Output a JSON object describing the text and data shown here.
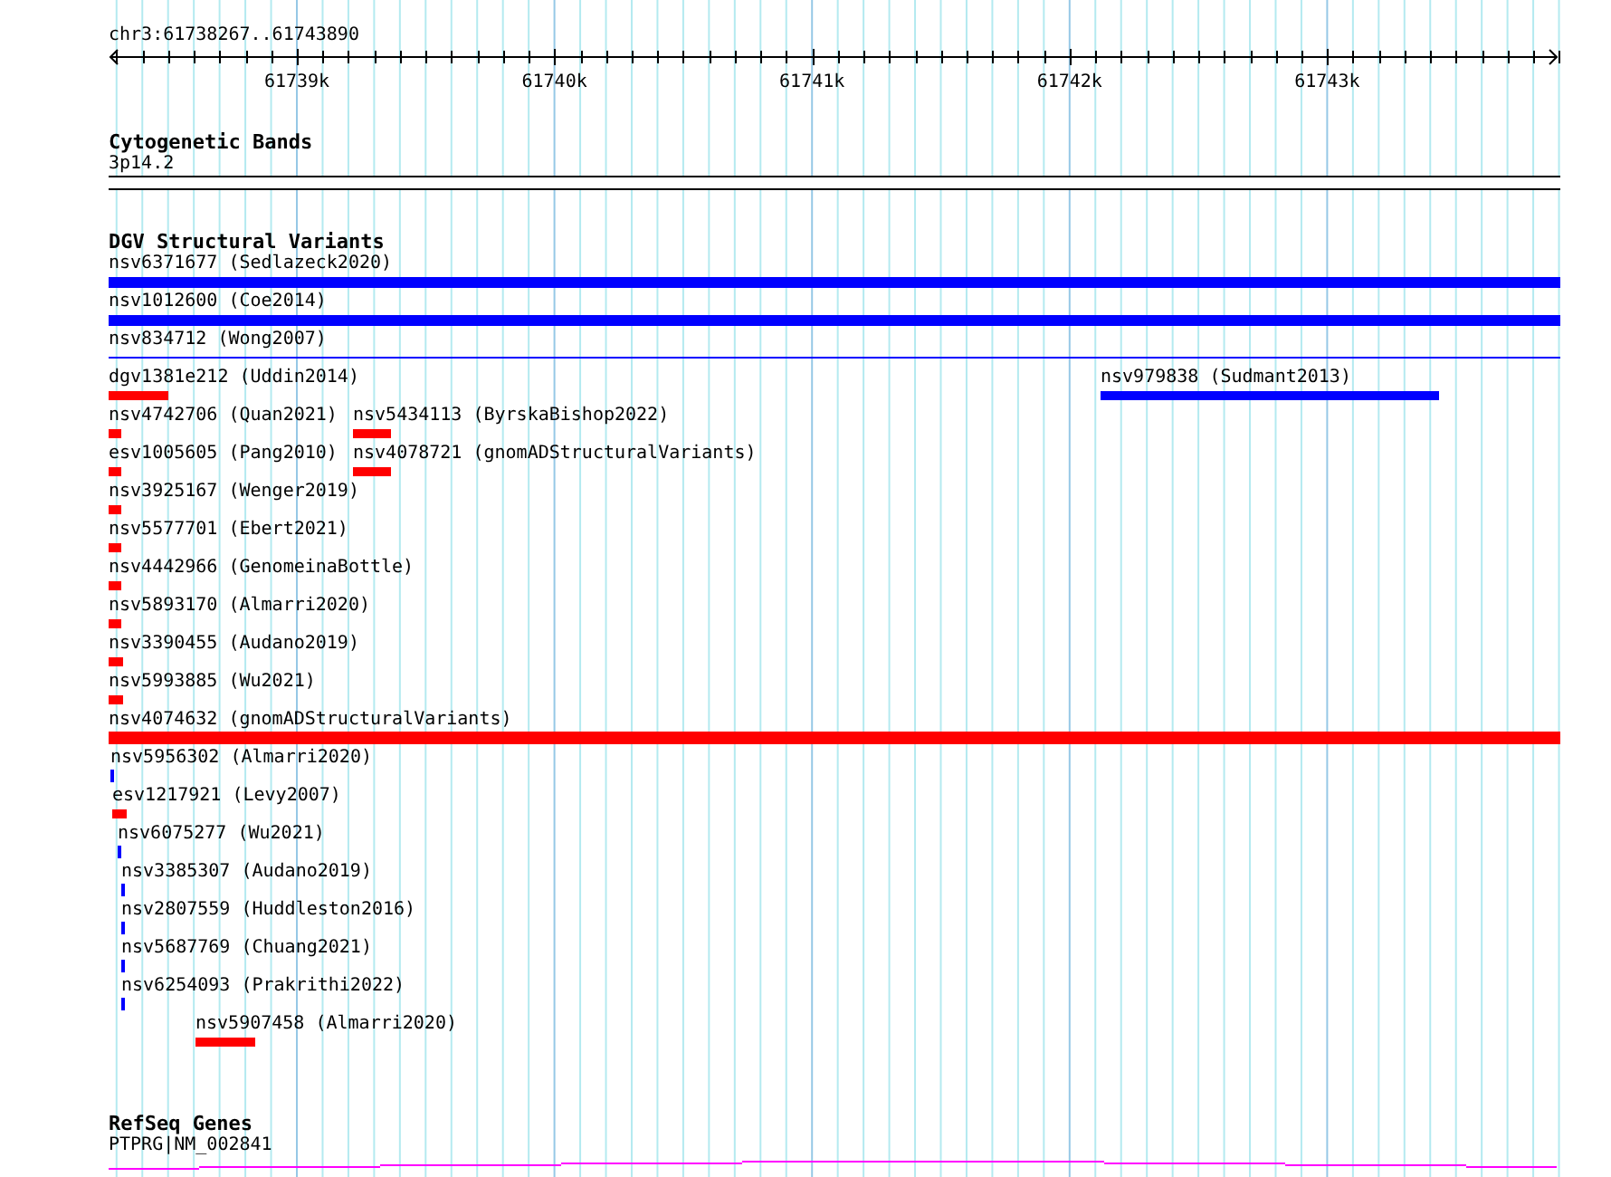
{
  "ruler": {
    "location": "chr3:61738267..61743890",
    "ticks": [
      "61739k",
      "61740k",
      "61741k",
      "61742k",
      "61743k"
    ]
  },
  "cytogenetic_bands": {
    "title": "Cytogenetic Bands",
    "band": "3p14.2"
  },
  "dgv_structural_variants": {
    "title": "DGV Structural Variants",
    "rows": [
      [
        {
          "label": "nsv6371677 (Sedlazeck2020)",
          "color": "#0000ff"
        }
      ],
      [
        {
          "label": "nsv1012600 (Coe2014)",
          "color": "#0000ff"
        }
      ],
      [
        {
          "label": "nsv834712 (Wong2007)",
          "color": "#0000ff"
        }
      ],
      [
        {
          "label": "dgv1381e212 (Uddin2014)",
          "color": "#ff0000"
        },
        {
          "label": "nsv979838 (Sudmant2013)",
          "color": "#0000ff"
        }
      ],
      [
        {
          "label": "nsv4742706 (Quan2021)",
          "color": "#ff0000"
        },
        {
          "label": "nsv5434113 (ByrskaBishop2022)",
          "color": "#ff0000"
        }
      ],
      [
        {
          "label": "esv1005605 (Pang2010)",
          "color": "#ff0000"
        },
        {
          "label": "nsv4078721 (gnomADStructuralVariants)",
          "color": "#ff0000"
        }
      ],
      [
        {
          "label": "nsv3925167 (Wenger2019)",
          "color": "#ff0000"
        }
      ],
      [
        {
          "label": "nsv5577701 (Ebert2021)",
          "color": "#ff0000"
        }
      ],
      [
        {
          "label": "nsv4442966 (GenomeinaBottle)",
          "color": "#ff0000"
        }
      ],
      [
        {
          "label": "nsv5893170 (Almarri2020)",
          "color": "#ff0000"
        }
      ],
      [
        {
          "label": "nsv3390455 (Audano2019)",
          "color": "#ff0000"
        }
      ],
      [
        {
          "label": "nsv5993885 (Wu2021)",
          "color": "#ff0000"
        }
      ],
      [
        {
          "label": "nsv4074632 (gnomADStructuralVariants)",
          "color": "#ff0000"
        }
      ],
      [
        {
          "label": "nsv5956302 (Almarri2020)",
          "color": "#0000ff"
        }
      ],
      [
        {
          "label": "esv1217921 (Levy2007)",
          "color": "#ff0000"
        }
      ],
      [
        {
          "label": "nsv6075277 (Wu2021)",
          "color": "#0000ff"
        }
      ],
      [
        {
          "label": "nsv3385307 (Audano2019)",
          "color": "#0000ff"
        }
      ],
      [
        {
          "label": "nsv2807559 (Huddleston2016)",
          "color": "#0000ff"
        }
      ],
      [
        {
          "label": "nsv5687769 (Chuang2021)",
          "color": "#0000ff"
        }
      ],
      [
        {
          "label": "nsv6254093 (Prakrithi2022)",
          "color": "#0000ff"
        }
      ],
      [
        {
          "label": "nsv5907458 (Almarri2020)",
          "color": "#ff0000"
        }
      ]
    ]
  },
  "refseq_genes": {
    "title": "RefSeq Genes",
    "gene": "PTPRG|NM_002841"
  }
}
